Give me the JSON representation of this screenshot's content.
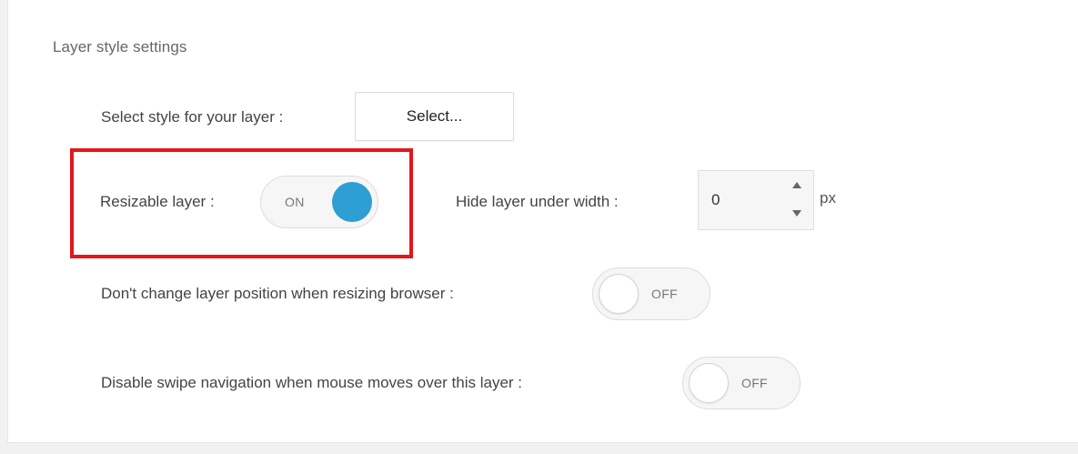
{
  "section": {
    "title": "Layer style settings"
  },
  "style_select": {
    "label": "Select style for your layer :",
    "button_label": "Select..."
  },
  "resizable": {
    "label": "Resizable layer :",
    "state": "ON"
  },
  "hide_under_width": {
    "label": "Hide layer under width :",
    "value": "0",
    "unit": "px"
  },
  "keep_position": {
    "label": "Don't change layer position when resizing browser :",
    "state": "OFF"
  },
  "disable_swipe": {
    "label": "Disable swipe navigation when mouse moves over this layer :",
    "state": "OFF"
  },
  "colors": {
    "accent": "#2e9fd3",
    "highlight": "#e3161b"
  }
}
